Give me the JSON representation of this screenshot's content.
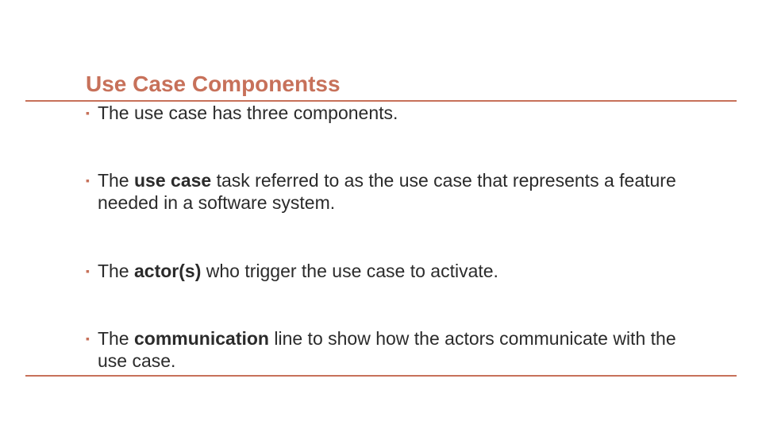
{
  "colors": {
    "accent": "#c7715a",
    "text": "#2b2b2b"
  },
  "title": "Use Case Componentss",
  "bullets": [
    {
      "pre": "The use case has three components.",
      "bold": "",
      "post": ""
    },
    {
      "pre": "The ",
      "bold": "use case",
      "post": " task referred to as the use case that represents a feature needed in a software system."
    },
    {
      "pre": "The ",
      "bold": "actor(s)",
      "post": " who trigger the use case to activate."
    },
    {
      "pre": "The ",
      "bold": "communication",
      "post": " line to show how the actors communicate with the use case."
    }
  ],
  "bullet_glyph": "▪"
}
